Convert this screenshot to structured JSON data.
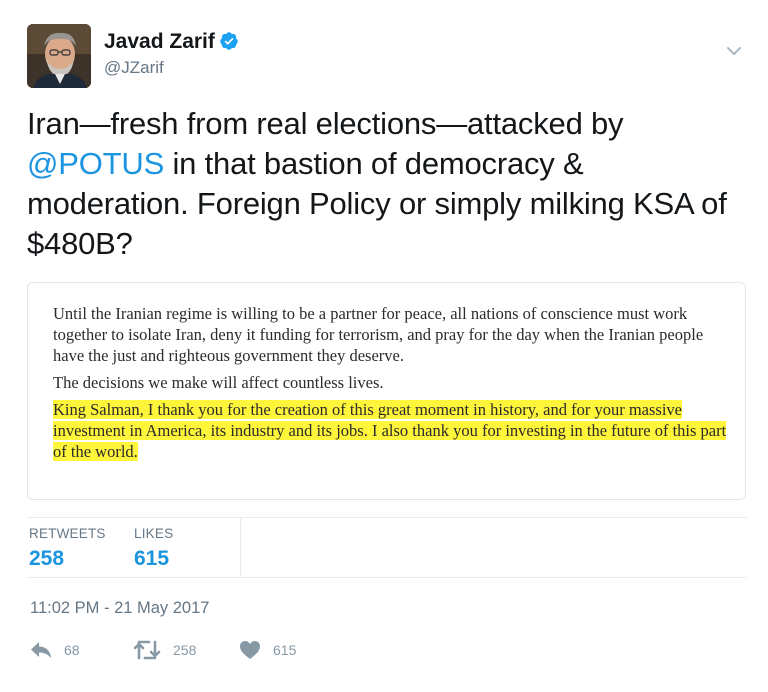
{
  "author": {
    "display_name": "Javad Zarif",
    "handle": "@JZarif",
    "verified": true
  },
  "tweet": {
    "text_part1": "Iran—fresh from real elections—attacked by ",
    "mention": "@POTUS",
    "text_part2": " in that bastion of democracy & moderation. Foreign Policy or simply milking KSA of $480B?"
  },
  "quoted_card": {
    "paragraph1": "Until the Iranian regime is willing to be a partner for peace, all nations of conscience must work together to isolate Iran, deny it funding for terrorism, and pray for the day when the Iranian people have the just and righteous government they deserve.",
    "paragraph2": "The decisions we make will affect countless lives.",
    "paragraph3_highlighted": "King Salman, I thank you for the creation of this great moment in history, and for your massive investment in America, its industry and its jobs. I also thank you for investing in the future of this part of the world.",
    "highlight_color": "#fff53a"
  },
  "stats": {
    "retweets_label": "RETWEETS",
    "retweets_value": "258",
    "likes_label": "LIKES",
    "likes_value": "615"
  },
  "timestamp": "11:02 PM - 21 May 2017",
  "actions": {
    "reply_count": "68",
    "retweet_count": "258",
    "like_count": "615"
  },
  "icons": {
    "verified": "verified-badge-icon",
    "caret": "chevron-down-icon",
    "reply": "reply-icon",
    "retweet": "retweet-icon",
    "like": "heart-icon"
  },
  "colors": {
    "accent": "#1b95e0",
    "muted": "#657786",
    "action_gray": "#8899a6",
    "text": "#14171a"
  }
}
